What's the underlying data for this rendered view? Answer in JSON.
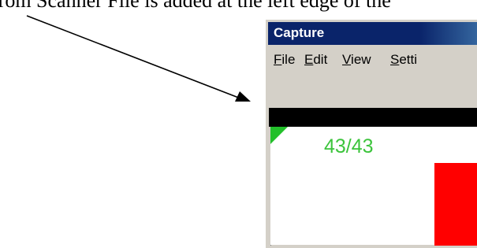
{
  "caption": {
    "text": "from Scanner File is added at the left edge of the"
  },
  "window": {
    "title": "Capture",
    "menu": [
      {
        "accel": "F",
        "rest": "ile"
      },
      {
        "accel": "E",
        "rest": "dit"
      },
      {
        "accel": "V",
        "rest": "iew"
      },
      {
        "accel": "S",
        "rest": "etti"
      }
    ]
  },
  "display": {
    "counter": "43/43"
  },
  "colors": {
    "counter_text": "#3cc43c",
    "marker": "#22c02a",
    "block": "#ff0000",
    "titlebar": "#0a246a"
  }
}
